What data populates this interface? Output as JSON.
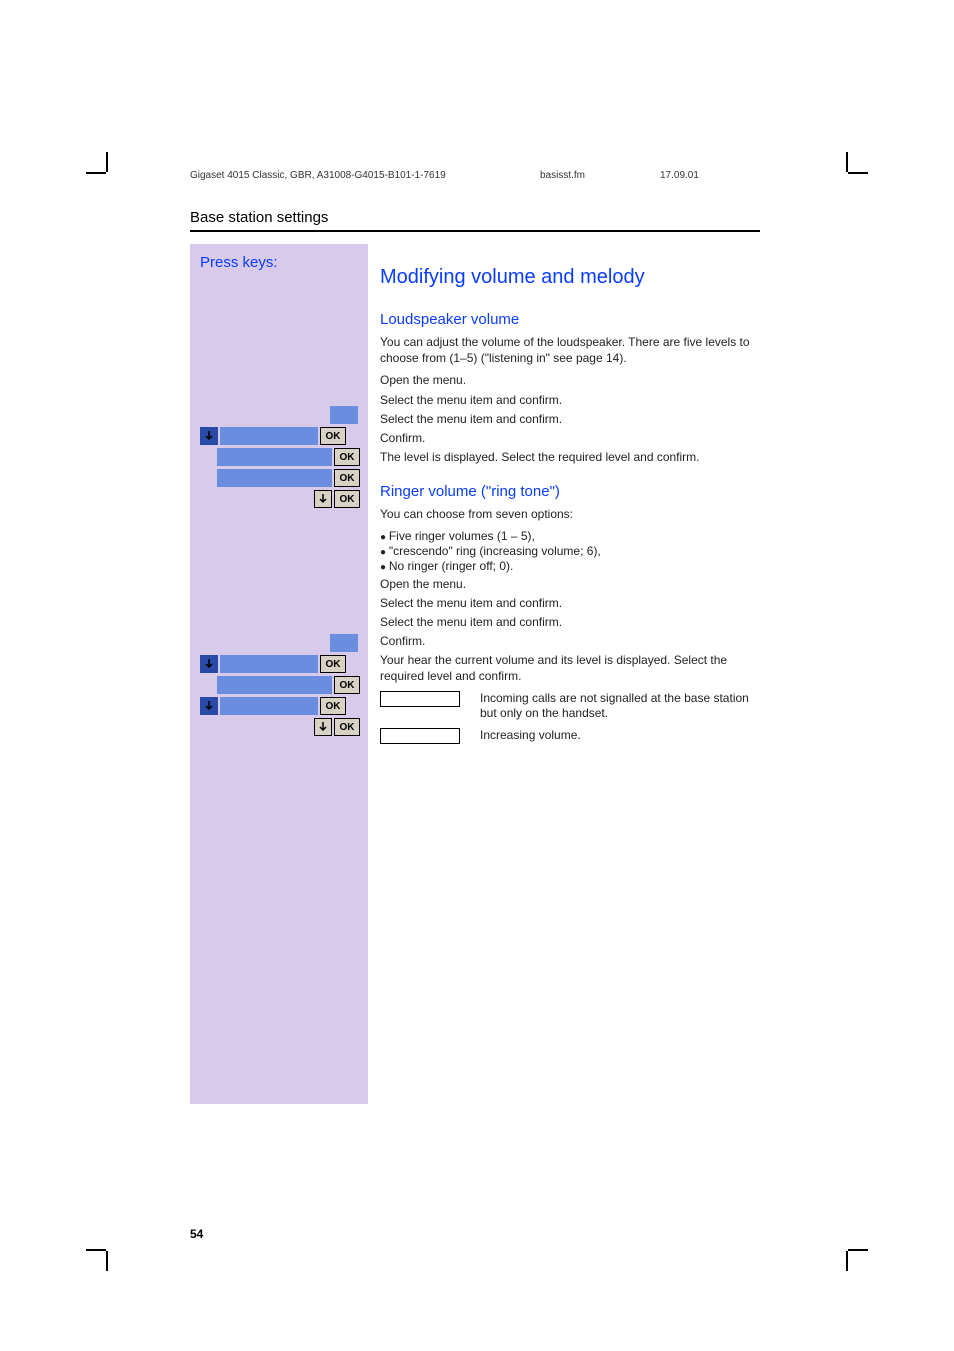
{
  "header": {
    "doc_id": "Gigaset 4015 Classic, GBR, A31008-G4015-B101-1-7619",
    "file": "basisst.fm",
    "date": "17.09.01"
  },
  "section_title": "Base station settings",
  "left": {
    "press_keys": "Press keys:",
    "ok": "OK"
  },
  "main": {
    "heading": "Modifying volume and melody",
    "loudspeaker": {
      "title": "Loudspeaker volume",
      "intro": "You can adjust the volume of the loudspeaker. There are five levels to choose from (1–5) (\"listening in\" see page 14).",
      "open_menu": "Open the menu.",
      "select_confirm": "Select the menu item and confirm.",
      "confirm": "Confirm.",
      "level_displayed": "The level is displayed. Select the required level and confirm."
    },
    "ringer": {
      "title": "Ringer volume (\"ring tone\")",
      "intro": "You can choose from seven options:",
      "bullets": [
        "Five ringer volumes (1 – 5),",
        "\"crescendo\" ring (increasing volume; 6),",
        "No ringer (ringer off; 0)."
      ],
      "open_menu": "Open the menu.",
      "select_confirm": "Select the menu item and confirm.",
      "confirm": "Confirm.",
      "hear_current": "Your hear the current volume and its level is displayed. Select the required level and confirm.",
      "no_signal": "Incoming calls are not signalled at the base station but only on the handset.",
      "increasing": "Increasing volume."
    }
  },
  "page_number": "54"
}
